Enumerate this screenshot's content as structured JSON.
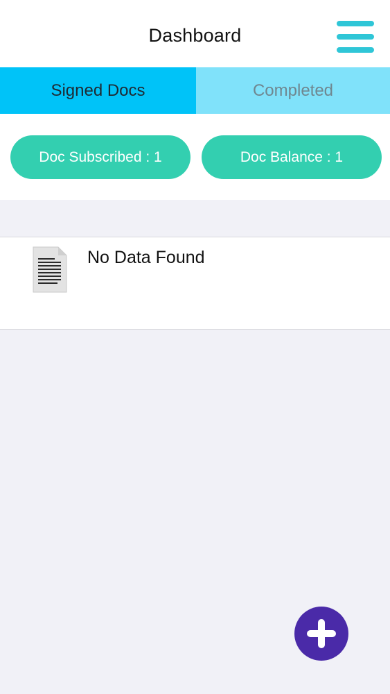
{
  "header": {
    "title": "Dashboard",
    "menu_icon": "hamburger-menu-icon",
    "menu_color": "#2fc6d7"
  },
  "tabs": [
    {
      "label": "Signed Docs",
      "active": true
    },
    {
      "label": "Completed",
      "active": false
    }
  ],
  "stats": {
    "subscribed_label": "Doc Subscribed : 1",
    "balance_label": "Doc Balance : 1"
  },
  "list": {
    "empty_message": "No Data Found",
    "item_icon": "document-icon"
  },
  "fab": {
    "icon": "plus-icon",
    "color": "#4a2aa8"
  },
  "colors": {
    "tab_active": "#00c3f8",
    "tab_inactive": "#80e2fa",
    "pill": "#33cfb0",
    "background": "#f1f1f7"
  }
}
